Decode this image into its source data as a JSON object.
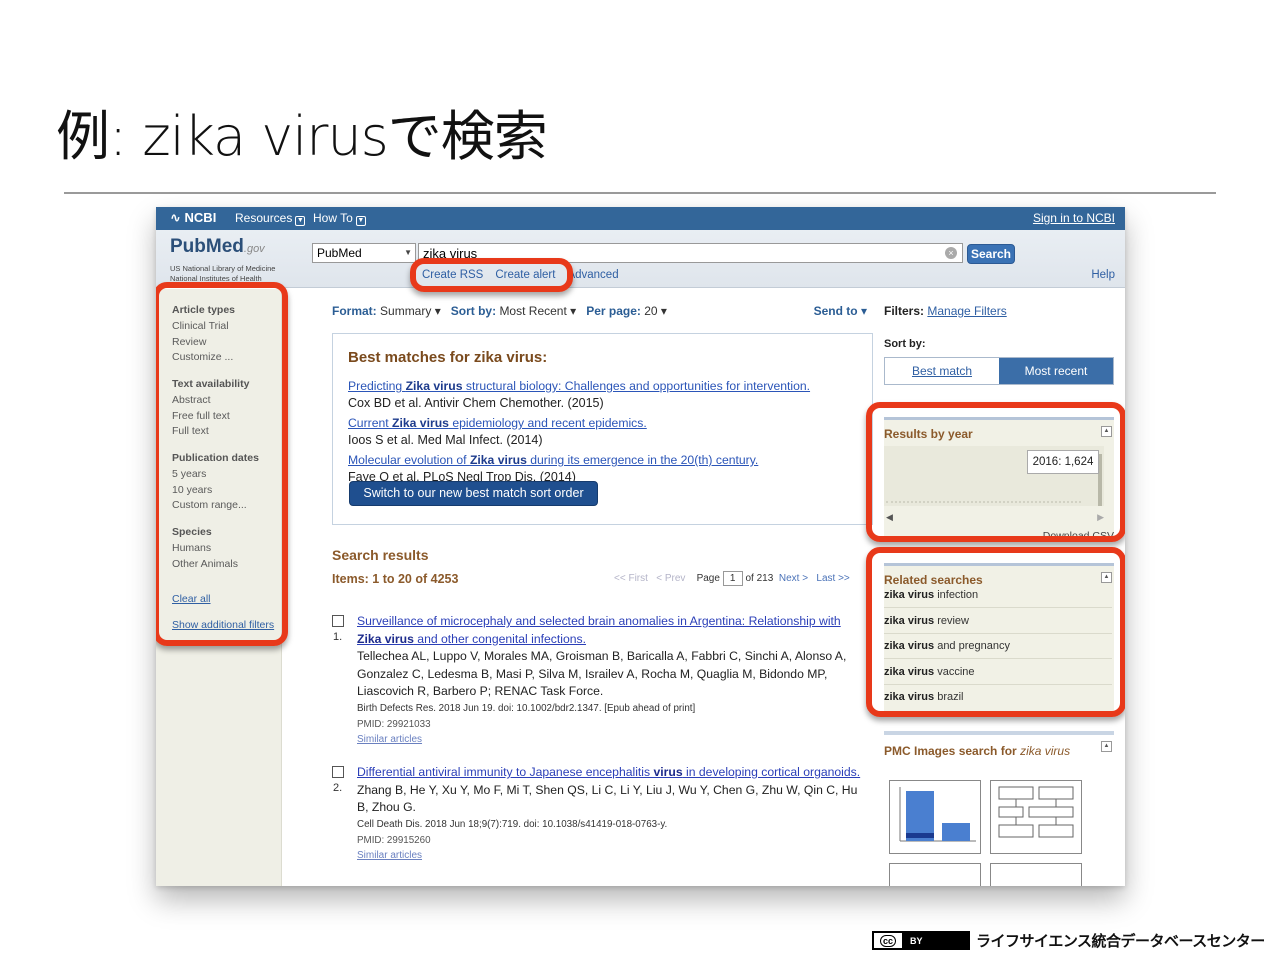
{
  "slide": {
    "title": "例: zika virusで検索",
    "footer_text": "ライフサイエンス統合データベースセンター",
    "license_cc": "cc",
    "license_by": "BY"
  },
  "ncbi_bar": {
    "logo": "NCBI",
    "resources": "Resources",
    "how_to": "How To",
    "sign_in": "Sign in to NCBI"
  },
  "masthead": {
    "logo_main": "PubMed",
    "logo_gov": ".gov",
    "nlm_line1": "US National Library of Medicine",
    "nlm_line2": "National Institutes of Health",
    "database": "PubMed",
    "query": "zika virus",
    "search_button": "Search",
    "create_rss": "Create RSS",
    "create_alert": "Create alert",
    "advanced": "Advanced",
    "help": "Help"
  },
  "sidebar": {
    "groups": [
      {
        "title": "Article types",
        "items": [
          "Clinical Trial",
          "Review",
          "Customize ..."
        ]
      },
      {
        "title": "Text availability",
        "items": [
          "Abstract",
          "Free full text",
          "Full text"
        ]
      },
      {
        "title": "Publication dates",
        "items": [
          "5 years",
          "10 years",
          "Custom range..."
        ]
      },
      {
        "title": "Species",
        "items": [
          "Humans",
          "Other Animals"
        ]
      }
    ],
    "clear_all": "Clear all",
    "show_additional": "Show additional filters"
  },
  "toolbar": {
    "format_label": "Format:",
    "format_value": "Summary",
    "sort_label": "Sort by:",
    "sort_value": "Most Recent",
    "per_page_label": "Per page:",
    "per_page_value": "20",
    "send_to": "Send to"
  },
  "best_matches": {
    "title": "Best matches for zika virus:",
    "items": [
      {
        "pre": "Predicting ",
        "bold": "Zika virus",
        "post": " structural biology: Challenges and opportunities for intervention.",
        "cite": "Cox BD et al. Antivir Chem Chemother. (2015)"
      },
      {
        "pre": "Current ",
        "bold": "Zika virus",
        "post": " epidemiology and recent epidemics.",
        "cite": "Ioos S et al. Med Mal Infect. (2014)"
      },
      {
        "pre": "Molecular evolution of ",
        "bold": "Zika virus",
        "post": " during its emergence in the 20(th) century.",
        "cite": "Faye O et al. PLoS Negl Trop Dis. (2014)"
      }
    ],
    "switch_button": "Switch to our new best match sort order"
  },
  "results": {
    "heading": "Search results",
    "items_line": "Items: 1 to 20 of 4253",
    "pager": {
      "first": "<< First",
      "prev": "< Prev",
      "page_label": "Page",
      "page": "1",
      "of": "of 213",
      "next": "Next >",
      "last": "Last >>"
    },
    "list": [
      {
        "num": "1.",
        "title_a": "Surveillance of microcephaly and selected brain anomalies in Argentina: Relationship with",
        "title_bold": "Zika virus",
        "title_b": " and other congenital infections.",
        "authors": "Tellechea AL, Luppo V, Morales MA, Groisman B, Baricalla A, Fabbri C, Sinchi A, Alonso A, Gonzalez C, Ledesma B, Masi P, Silva M, Israilev A, Rocha M, Quaglia M, Bidondo MP, Liascovich R, Barbero P; RENAC Task Force.",
        "meta": "Birth Defects Res. 2018 Jun 19. doi: 10.1002/bdr2.1347. [Epub ahead of print]",
        "pmid": "PMID: 29921033",
        "similar": "Similar articles"
      },
      {
        "num": "2.",
        "title_a": "Differential antiviral immunity to Japanese encephalitis ",
        "title_bold": "virus",
        "title_b": " in developing cortical organoids.",
        "authors": "Zhang B, He Y, Xu Y, Mo F, Mi T, Shen QS, Li C, Li Y, Liu J, Wu Y, Chen G, Zhu W, Qin C, Hu B, Zhou G.",
        "meta": "Cell Death Dis. 2018 Jun 18;9(7):719. doi: 10.1038/s41419-018-0763-y.",
        "pmid": "PMID: 29915260",
        "similar": "Similar articles"
      }
    ]
  },
  "right": {
    "filters_label": "Filters:",
    "manage_filters": "Manage Filters",
    "sort_by": "Sort by:",
    "best_match": "Best match",
    "most_recent": "Most recent",
    "results_by_year": "Results by year",
    "tooltip": "2016: 1,624",
    "download_csv": "Download CSV",
    "related_title": "Related searches",
    "related": [
      {
        "bold": "zika virus",
        "rest": " infection"
      },
      {
        "bold": "zika virus",
        "rest": " review"
      },
      {
        "bold": "zika virus",
        "rest": " and pregnancy"
      },
      {
        "bold": "zika virus",
        "rest": " vaccine"
      },
      {
        "bold": "zika virus",
        "rest": " brazil"
      }
    ],
    "pmc_title": "PMC Images search for ",
    "pmc_query": "zika virus"
  },
  "colors": {
    "ncbi_blue": "#336699",
    "callout_red": "#e8391a",
    "heading_brown": "#8b5a2b",
    "link_blue": "#2b55b8"
  }
}
